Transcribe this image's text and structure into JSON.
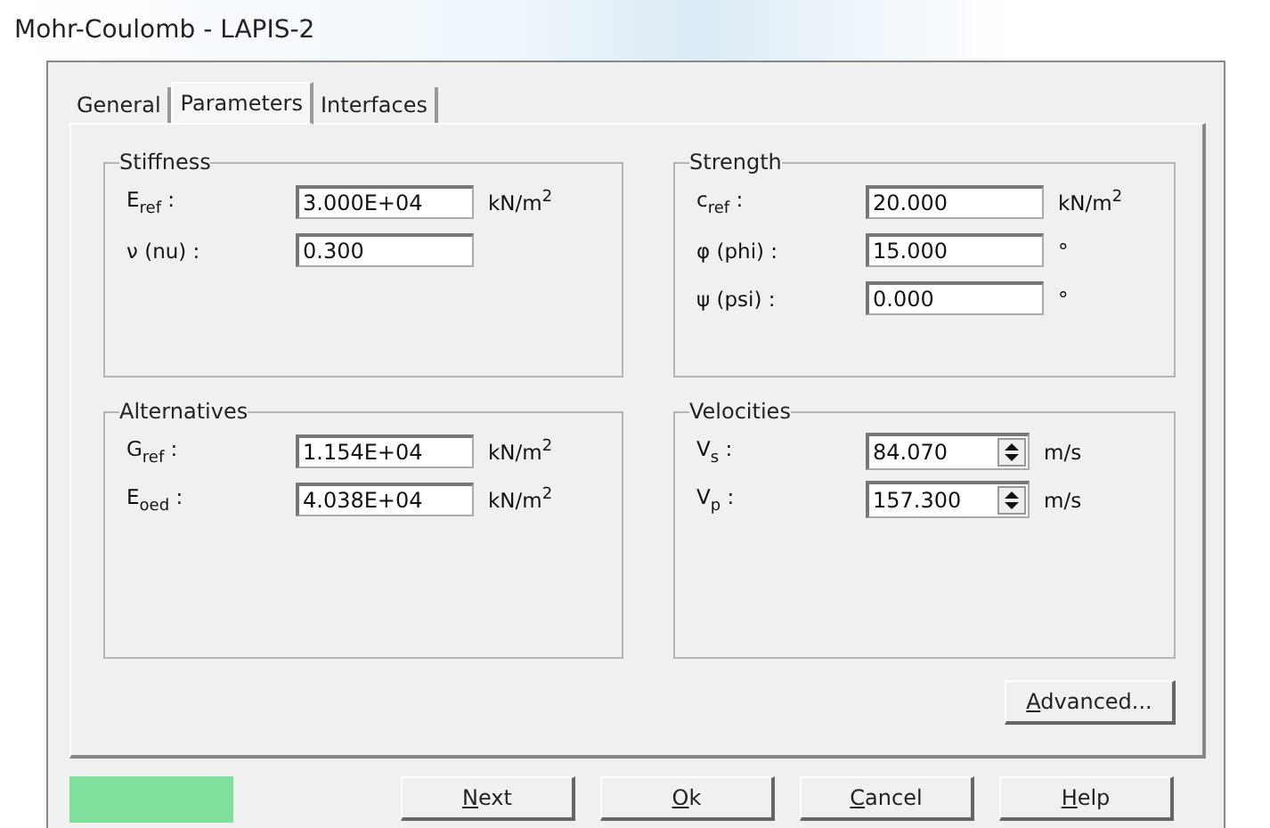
{
  "window": {
    "title": "Mohr-Coulomb - LAPIS-2"
  },
  "tabs": [
    {
      "label": "General",
      "selected": false
    },
    {
      "label": "Parameters",
      "selected": true
    },
    {
      "label": "Interfaces",
      "selected": false
    }
  ],
  "groups": [
    {
      "title": "Stiffness",
      "rows": [
        {
          "label": "E$_{ref}$ :",
          "value": "3.000E+04",
          "unit": "kN/m$^{2}$",
          "kind": "text"
        },
        {
          "label": "ν (nu) :",
          "value": "0.300",
          "kind": "text"
        }
      ]
    },
    {
      "title": "Strength",
      "rows": [
        {
          "label": "c$_{ref}$ :",
          "value": "20.000",
          "unit": "kN/m$^{2}$",
          "kind": "text"
        },
        {
          "label": "φ (phi) :",
          "value": "15.000",
          "unit": "°",
          "kind": "text"
        },
        {
          "label": "ψ (psi) :",
          "value": "0.000",
          "unit": "°",
          "kind": "text"
        }
      ]
    },
    {
      "title": "Alternatives",
      "rows": [
        {
          "label": "G$_{ref}$ :",
          "value": "1.154E+04",
          "unit": "kN/m$^{2}$",
          "kind": "text"
        },
        {
          "label": "E$_{oed}$ :",
          "value": "4.038E+04",
          "unit": "kN/m$^{2}$",
          "kind": "text"
        }
      ]
    },
    {
      "title": "Velocities",
      "rows": [
        {
          "label": "V$_{s}$ :",
          "value": "84.070",
          "unit": "m/s",
          "kind": "spin"
        },
        {
          "label": "V$_{p}$ :",
          "value": "157.300",
          "unit": "m/s",
          "kind": "spin"
        }
      ]
    }
  ],
  "advanced_button": {
    "label": "Advanced...",
    "mnemonic": true
  },
  "material_color": {
    "color": "#7ee09c"
  },
  "buttons": [
    {
      "label": "Next",
      "mnemonic": true
    },
    {
      "label": "Ok",
      "mnemonic": true
    },
    {
      "label": "Cancel",
      "mnemonic": true
    },
    {
      "label": "Help",
      "mnemonic": true
    }
  ]
}
